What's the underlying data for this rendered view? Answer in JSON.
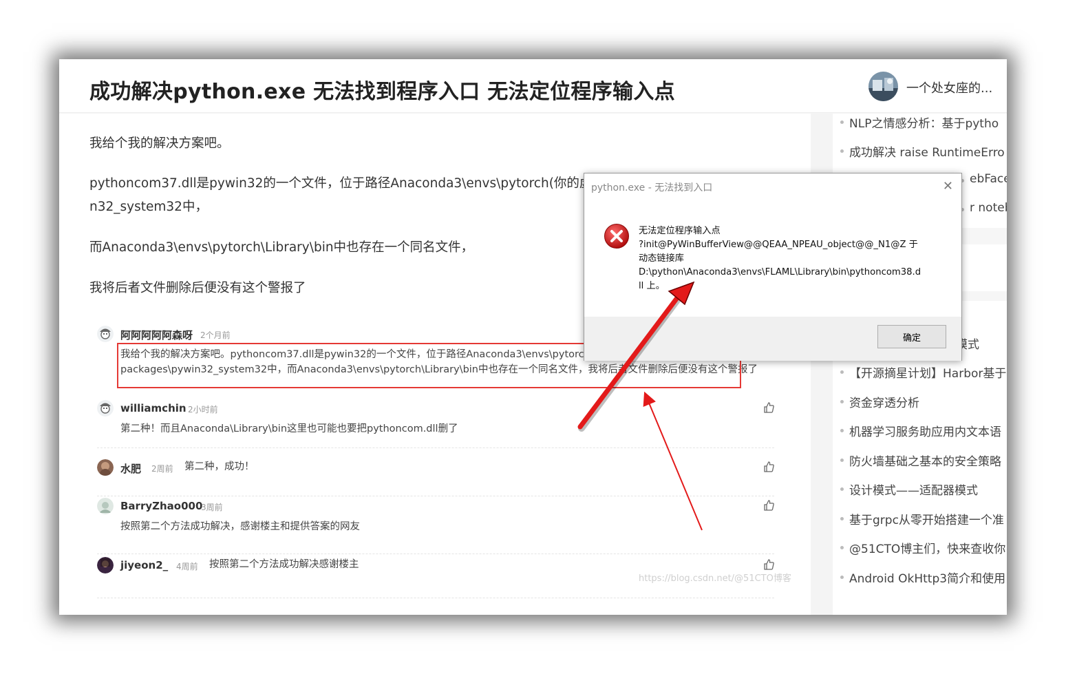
{
  "header": {
    "title": "成功解决python.exe 无法找到程序入口 无法定位程序输入点",
    "author": "一个处女座的..."
  },
  "article": {
    "paragraphs": [
      "我给个我的解决方案吧。",
      "pythoncom37.dll是pywin32的一个文件，位于路径Anaconda3\\envs\\pytorch(你的虚",
      "n32_system32中，",
      "而Anaconda3\\envs\\pytorch\\Library\\bin中也存在一个同名文件，",
      "我将后者文件删除后便没有这个警报了"
    ]
  },
  "comments": [
    {
      "name": "阿阿阿阿阿森呀",
      "time": "2个月前",
      "text_line1": "我给个我的解决方案吧。pythoncom37.dll是pywin32的一个文件，位于路径Anaconda3\\envs\\pytorch(你",
      "text_line2": "packages\\pywin32_system32中，而Anaconda3\\envs\\pytorch\\Library\\bin中也存在一个同名文件，我将后者文件删除后便没有这个警报了"
    },
    {
      "name": "williamchin",
      "time": "2小时前",
      "text": "第二种！而且Anaconda\\Library\\bin这里也可能也要把pythoncom.dll删了"
    },
    {
      "name": "水肥",
      "time": "2周前",
      "text": "第二种，成功！"
    },
    {
      "name": "BarryZhao000",
      "time": "3周前",
      "text": "按照第二个方法成功解决，感谢楼主和提供答案的网友"
    },
    {
      "name": "jiyeon2_",
      "time": "4周前",
      "text": "按照第二个方法成功解决感谢楼主"
    }
  ],
  "sidebar": {
    "items": [
      "NLP之情感分析：基于pytho",
      "成功解决 raise RuntimeErro",
      "ebFace",
      "r notebo",
      "模式",
      "【开源摘星计划】Harbor基于",
      "资金穿透分析",
      "机器学习服务助应用内文本语",
      "防火墙基础之基本的安全策略",
      "设计模式——适配器模式",
      "基于grpc从零开始搭建一个准",
      "@51CTO博主们，快来查收你",
      "Android OkHttp3简介和使用"
    ]
  },
  "dialog": {
    "title": "python.exe - 无法找到入口",
    "close": "✕",
    "message_lines": [
      "无法定位程序输入点",
      "?init@PyWinBufferView@@QEAA_NPEAU_object@@_N1@Z 于",
      "动态链接库",
      "D:\\python\\Anaconda3\\envs\\FLAML\\Library\\bin\\pythoncom38.d",
      "ll 上。"
    ],
    "ok_label": "确定"
  },
  "watermark": "https://blog.csdn.net/@51CTO博客",
  "colors": {
    "highlight": "#e53935",
    "arrow": "#e31a1a"
  }
}
